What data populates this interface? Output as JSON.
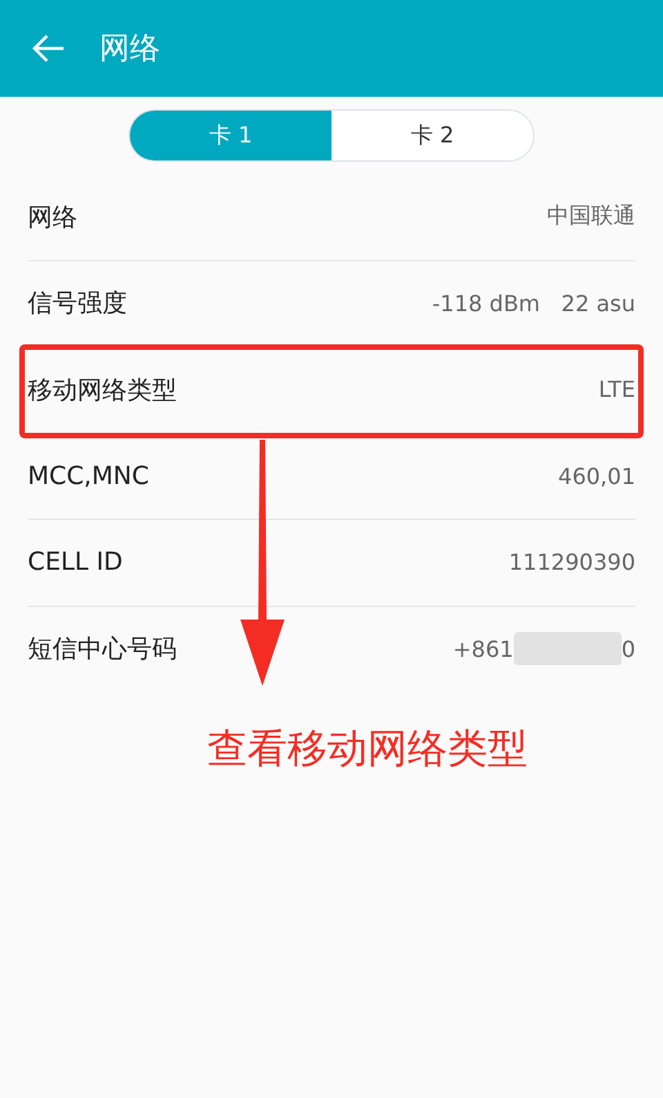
{
  "header": {
    "title": "网络"
  },
  "sim_tabs": [
    {
      "label": "卡 1",
      "selected": true
    },
    {
      "label": "卡 2",
      "selected": false
    }
  ],
  "rows": [
    {
      "label": "网络",
      "value": "中国联通",
      "highlighted": false
    },
    {
      "label": "信号强度",
      "value": "-118 dBm   22 asu",
      "highlighted": false
    },
    {
      "label": "移动网络类型",
      "value": "LTE",
      "highlighted": true
    },
    {
      "label": "MCC,MNC",
      "value": "460,01",
      "highlighted": false
    },
    {
      "label": "CELL ID",
      "value": "111290390",
      "highlighted": false
    },
    {
      "label": "短信中心号码",
      "value": "+861",
      "value_end": "0",
      "redacted": true,
      "highlighted": false
    }
  ],
  "annotation": {
    "caption": "查看移动网络类型"
  }
}
